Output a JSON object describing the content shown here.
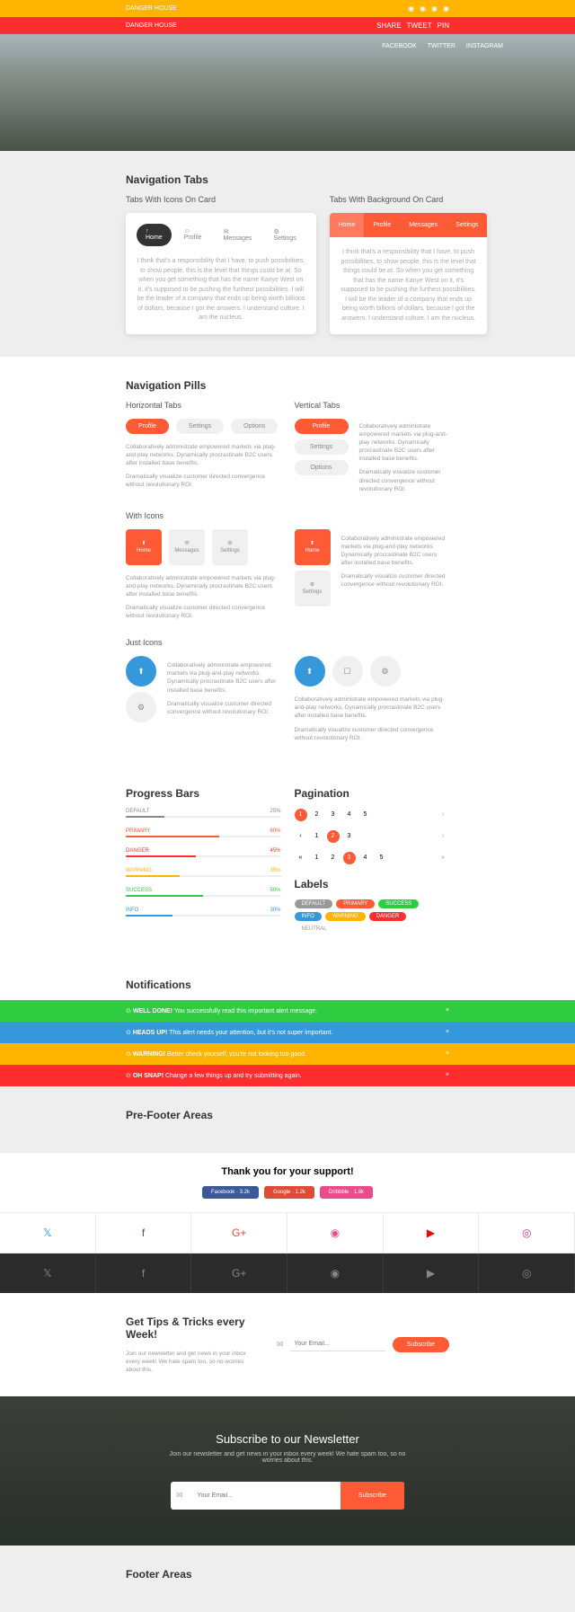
{
  "topbar": {
    "brand": "DANGER HOUSE"
  },
  "redbar": {
    "brand": "DANGER HOUSE",
    "share": "SHARE",
    "tweet": "TWEET",
    "pin": "PIN"
  },
  "hero_social": {
    "facebook": "FACEBOOK",
    "twitter": "TWITTER",
    "instagram": "INSTAGRAM"
  },
  "nav_tabs": {
    "title": "Navigation Tabs",
    "sub1": "Tabs With Icons On Card",
    "sub2": "Tabs With Background On Card",
    "tabs": [
      "Home",
      "Profile",
      "Messages",
      "Settings"
    ],
    "body": "I think that's a responsibility that I have, to push possibilities, to show people, this is the level that things could be at. So when you get something that has the name Kanye West on it, it's supposed to be pushing the furthest possibilities. I will be the leader of a company that ends up being worth billions of dollars, because I got the answers. I understand culture. I am the nucleus."
  },
  "nav_pills": {
    "title": "Navigation Pills",
    "horiz": "Horizontal Tabs",
    "vert": "Vertical Tabs",
    "withicons": "With Icons",
    "justicons": "Just Icons",
    "pills": [
      "Profile",
      "Settings",
      "Options"
    ],
    "icon_labels": [
      "Home",
      "Messages",
      "Settings"
    ],
    "text1": "Collaboratively administrate empowered markets via plug-and-play networks. Dynamically procrastinate B2C users after installed base benefits.",
    "text2": "Dramatically visualize customer directed convergence without revolutionary ROI."
  },
  "progress": {
    "title": "Progress Bars",
    "bars": [
      {
        "label": "DEFAULT",
        "pct": "25%",
        "color": "#888",
        "w": "25%"
      },
      {
        "label": "PRIMARY",
        "pct": "60%",
        "color": "#ff5a36",
        "w": "60%"
      },
      {
        "label": "DANGER",
        "pct": "45%",
        "color": "#ff2e2e",
        "w": "45%"
      },
      {
        "label": "WARNING",
        "pct": "35%",
        "color": "#ffb400",
        "w": "35%"
      },
      {
        "label": "SUCCESS",
        "pct": "50%",
        "color": "#2ecc40",
        "w": "50%"
      },
      {
        "label": "INFO",
        "pct": "30%",
        "color": "#3498db",
        "w": "30%"
      }
    ]
  },
  "pagination": {
    "title": "Pagination"
  },
  "labels": {
    "title": "Labels",
    "items": [
      {
        "t": "DEFAULT",
        "c": "#999"
      },
      {
        "t": "PRIMARY",
        "c": "#ff5a36"
      },
      {
        "t": "SUCCESS",
        "c": "#2ecc40"
      },
      {
        "t": "INFO",
        "c": "#3498db"
      },
      {
        "t": "WARNING",
        "c": "#ffb400"
      },
      {
        "t": "DANGER",
        "c": "#ff2e2e"
      }
    ],
    "neutral": "NEUTRAL"
  },
  "notifications": {
    "title": "Notifications",
    "alerts": [
      {
        "bg": "#2ecc40",
        "strong": "WELL DONE!",
        "msg": " You successfully read this important alert message."
      },
      {
        "bg": "#3498db",
        "strong": "HEADS UP!",
        "msg": " This alert needs your attention, but it's not super important."
      },
      {
        "bg": "#ffb400",
        "strong": "WARNING!",
        "msg": " Better check yourself, you're not looking too good."
      },
      {
        "bg": "#ff2e2e",
        "strong": "OH SNAP!",
        "msg": " Change a few things up and try submitting again."
      }
    ]
  },
  "prefooter": {
    "title": "Pre-Footer Areas",
    "thanks": "Thank you for your support!",
    "btns": [
      {
        "t": "Facebook · 3.2k",
        "c": "#3b5998"
      },
      {
        "t": "Google · 1.2k",
        "c": "#dd4b39"
      },
      {
        "t": "Dribbble · 1.8k",
        "c": "#ea4c89"
      }
    ]
  },
  "tips": {
    "title": "Get Tips & Tricks every Week!",
    "sub": "Join our newsletter and get news in your inbox every week! We hate spam too, so no worries about this.",
    "placeholder": "Your Email...",
    "btn": "Subscribe"
  },
  "newsletter": {
    "title": "Subscribe to our Newsletter",
    "sub": "Join our newsletter and get news in your inbox every week! We hate spam too, so no worries about this.",
    "placeholder": "Your Email...",
    "btn": "Subscribe"
  },
  "footer": {
    "title": "Footer Areas"
  }
}
